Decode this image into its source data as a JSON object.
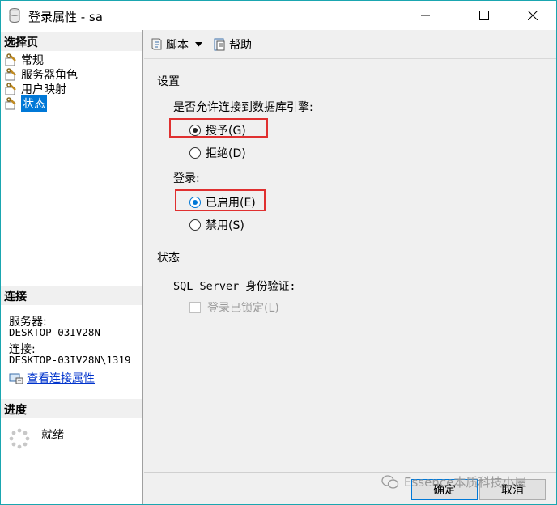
{
  "window": {
    "title": "登录属性 - sa"
  },
  "left_pane": {
    "select_page_header": "选择页",
    "pages": [
      {
        "label": "常规"
      },
      {
        "label": "服务器角色"
      },
      {
        "label": "用户映射"
      },
      {
        "label": "状态",
        "selected": true
      }
    ],
    "connection_header": "连接",
    "server_label": "服务器:",
    "server_value": "DESKTOP-03IV28N",
    "connection_label": "连接:",
    "connection_value": "DESKTOP-03IV28N\\1319",
    "view_properties_link": "查看连接属性",
    "progress_header": "进度",
    "progress_status": "就绪"
  },
  "toolbar": {
    "script_label": "脚本",
    "help_label": "帮助"
  },
  "settings": {
    "section_title": "设置",
    "permission_question": "是否允许连接到数据库引擎:",
    "grant_option": "授予(G)",
    "deny_option": "拒绝(D)",
    "login_label": "登录:",
    "enabled_option": "已启用(E)",
    "disabled_option": "禁用(S)",
    "permission_selected": "授予(G)",
    "login_selected": "已启用(E)"
  },
  "status": {
    "section_title": "状态",
    "auth_label": "SQL Server 身份验证:",
    "locked_checkbox_label": "登录已锁定(L)",
    "locked_checked": false,
    "locked_enabled": false
  },
  "buttons": {
    "ok": "确定",
    "cancel": "取消"
  },
  "watermark": {
    "text": "Essence本质科技小屋"
  },
  "colors": {
    "accent": "#0078d7",
    "highlight_box": "#e03030",
    "window_border": "#1aa6b0"
  }
}
